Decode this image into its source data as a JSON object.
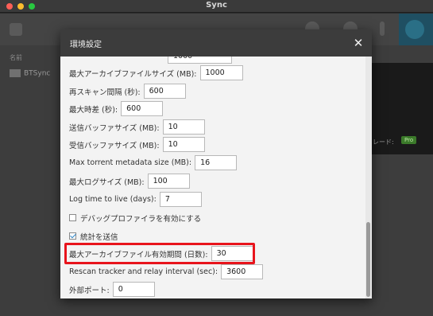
{
  "window": {
    "title": "Sync"
  },
  "background_app": {
    "sidebar_header": "名前",
    "folder_name": "BTSync",
    "upgrade_text": "レード:",
    "pro_badge": "Pro"
  },
  "dialog": {
    "title": "環境設定",
    "close_symbol": "✕",
    "settings": [
      {
        "id": "partial",
        "label": "",
        "value": "1000"
      },
      {
        "id": "max_archive_size",
        "label": "最大アーカイブファイルサイズ (MB):",
        "value": "1000"
      },
      {
        "id": "rescan_interval",
        "label": "再スキャン間隔 (秒):",
        "value": "600"
      },
      {
        "id": "max_time_diff",
        "label": "最大時差 (秒):",
        "value": "600"
      },
      {
        "id": "send_buffer",
        "label": "送信バッファサイズ (MB):",
        "value": "10"
      },
      {
        "id": "recv_buffer",
        "label": "受信バッファサイズ (MB):",
        "value": "10"
      },
      {
        "id": "torrent_meta",
        "label": "Max torrent metadata size (MB):",
        "value": "16"
      },
      {
        "id": "max_log",
        "label": "最大ログサイズ (MB):",
        "value": "100"
      },
      {
        "id": "log_ttl",
        "label": "Log time to live (days):",
        "value": "7"
      },
      {
        "id": "archive_period",
        "label": "最大アーカイブファイル有効期間 (日数):",
        "value": "30"
      },
      {
        "id": "rescan_tracker",
        "label": "Rescan tracker and relay interval (sec):",
        "value": "3600"
      },
      {
        "id": "external_port",
        "label": "外部ポート:",
        "value": "0"
      }
    ],
    "checkboxes": [
      {
        "id": "debug_profiler",
        "label": "デバッグプロファイラを有効にする",
        "checked": false
      },
      {
        "id": "send_stats",
        "label": "統計を送信",
        "checked": true
      }
    ]
  },
  "colors": {
    "highlight": "#e8141c",
    "checkbox_accent": "#2f86c7"
  }
}
